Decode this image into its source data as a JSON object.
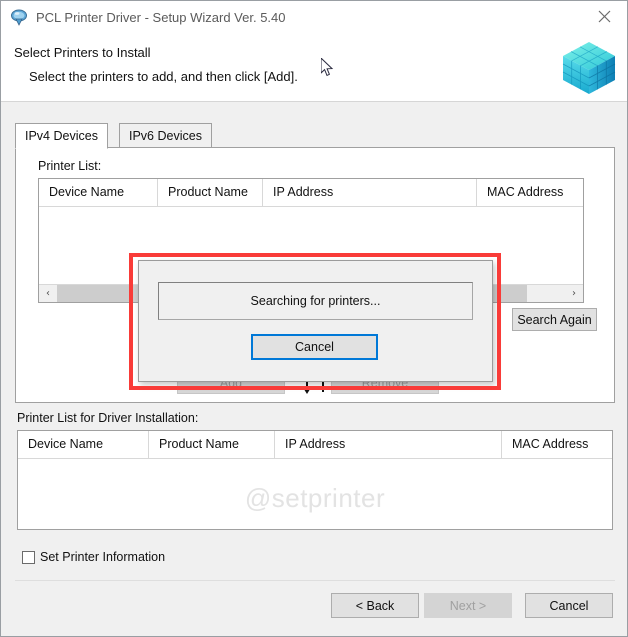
{
  "window": {
    "title": "PCL Printer Driver - Setup Wizard Ver. 5.40",
    "close_label": "×",
    "icon_name": "printer-driver-icon"
  },
  "header": {
    "title": "Select Printers to Install",
    "subtitle": "Select the printers to add, and then click [Add].",
    "graphic_name": "cube-stack-graphic"
  },
  "tabs": [
    {
      "label": "IPv4 Devices",
      "active": true
    },
    {
      "label": "IPv6 Devices",
      "active": false
    }
  ],
  "printer_list": {
    "label": "Printer List:",
    "columns": [
      "Device Name",
      "Product Name",
      "IP Address",
      "MAC Address"
    ],
    "rows": [],
    "scrollbar": {
      "left_arrow": "‹",
      "right_arrow": "›"
    }
  },
  "buttons": {
    "search_again": "Search Again",
    "add": "Add",
    "remove": "Remove"
  },
  "install_list": {
    "label": "Printer List for Driver Installation:",
    "columns": [
      "Device Name",
      "Product Name",
      "IP Address",
      "MAC Address"
    ],
    "rows": [],
    "watermark": "@setprinter"
  },
  "options": {
    "set_printer_information": {
      "label": "Set Printer Information",
      "checked": false
    }
  },
  "footer": {
    "back": "< Back",
    "next": "Next >",
    "cancel": "Cancel",
    "next_disabled": true
  },
  "modal": {
    "message": "Searching for printers...",
    "cancel": "Cancel"
  },
  "colors": {
    "highlight": "#f93b38",
    "focus": "#0078d7",
    "window_bg": "#f0f0f0",
    "field_bg": "#ffffff"
  }
}
